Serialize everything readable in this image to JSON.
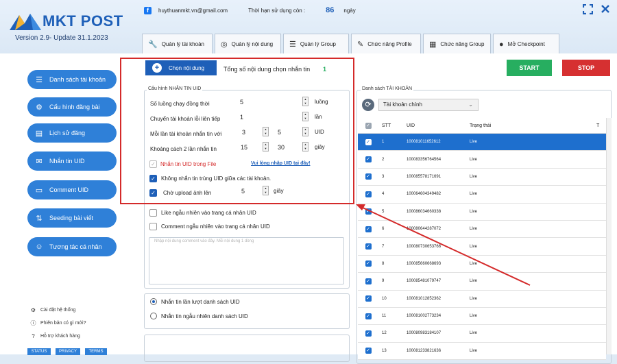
{
  "app": {
    "title": "MKT POST",
    "version": "Version 2.9- Update 31.1.2023",
    "email": "huythuanmkt.vn@gmail.com",
    "days_label": "Thời hạn sử dụng còn :",
    "days_value": "86",
    "days_unit": "ngày"
  },
  "tabs": [
    {
      "label": "Quản lý tài khoản",
      "icon": "wrench-icon"
    },
    {
      "label": "Quản lý nội dung",
      "icon": "content-icon"
    },
    {
      "label": "Quản lý Group",
      "icon": "list-icon"
    },
    {
      "label": "Chức năng Profile",
      "icon": "pencil-icon"
    },
    {
      "label": "Chức năng Group",
      "icon": "calendar-icon"
    },
    {
      "label": "Mở Checkpoint",
      "icon": "user-icon"
    }
  ],
  "sidebar": {
    "items": [
      {
        "label": "Danh sách tài khoản",
        "icon": "list-icon"
      },
      {
        "label": "Cấu hình đăng bài",
        "icon": "gears-icon"
      },
      {
        "label": "Lịch sử đăng",
        "icon": "history-icon"
      },
      {
        "label": "Nhắn tin UID",
        "icon": "message-icon"
      },
      {
        "label": "Comment UID",
        "icon": "comment-icon"
      },
      {
        "label": "Seeding bài viết",
        "icon": "seeding-icon"
      },
      {
        "label": "Tương tác cá nhân",
        "icon": "person-icon"
      }
    ],
    "footer": [
      "Cài đặt hệ thống",
      "Phiên bản có gì mới?",
      "Hỗ trợ khách hàng"
    ],
    "badges": [
      "STATUS",
      "PRIVACY",
      "TERMS"
    ]
  },
  "content": {
    "choose_button": "Chọn nội dung",
    "total_label": "Tổng số nội dung chọn nhắn tin",
    "total_value": "1"
  },
  "config": {
    "legend": "Cấu hình NHẮN TIN UID",
    "threads_label": "Số luồng chạy đồng thời",
    "threads_value": "5",
    "threads_unit": "luồng",
    "switch_label": "Chuyển tài khoản lỗi liên tiếp",
    "switch_value": "1",
    "switch_unit": "lần",
    "per_account_label": "Mỗi lần tài khoản nhắn tin với",
    "per_account_min": "3",
    "per_account_max": "5",
    "per_account_unit": "UID",
    "gap_label": "Khoảng cách 2 lần nhắn tin",
    "gap_min": "15",
    "gap_max": "30",
    "gap_unit": "giây",
    "file_label": "Nhắn tin UID trong File",
    "file_link": "Vui lòng nhập  UID tại đây!",
    "no_dup_label": "Không nhắn tin trùng UID giữa các tài khoản.",
    "wait_label": "Chờ upload ảnh lên",
    "wait_value": "5",
    "wait_unit": "giây",
    "like_label": "Like ngẫu nhiên vào trang cá nhân UID",
    "comment_label": "Comment ngẫu nhiên vào trang cá nhân UID",
    "comment_placeholder": "Nhập nội dung comment vào đây. Mỗi nội dung 1 dòng",
    "radio_seq": "Nhắn tin lần lượt danh sách UID",
    "radio_rand": "Nhắn tin ngẫu nhiên danh sách UID"
  },
  "actions": {
    "start": "START",
    "stop": "STOP"
  },
  "accounts": {
    "legend": "Danh sách TÀI KHOẢN",
    "dropdown": "Tài khoản chính",
    "columns": [
      "STT",
      "UID",
      "Trạng thái",
      "T"
    ],
    "rows": [
      {
        "stt": "1",
        "uid": "100081011652612",
        "status": "Live"
      },
      {
        "stt": "2",
        "uid": "100083356764564",
        "status": "Live"
      },
      {
        "stt": "3",
        "uid": "100085578171691",
        "status": "Live"
      },
      {
        "stt": "4",
        "uid": "100064604349482",
        "status": "Live"
      },
      {
        "stt": "5",
        "uid": "100086034660338",
        "status": "Live"
      },
      {
        "stt": "6",
        "uid": "100080644287072",
        "status": "Live"
      },
      {
        "stt": "7",
        "uid": "100080730653766",
        "status": "Live"
      },
      {
        "stt": "8",
        "uid": "100085660668693",
        "status": "Live"
      },
      {
        "stt": "9",
        "uid": "100085481079747",
        "status": "Live"
      },
      {
        "stt": "10",
        "uid": "100081012852362",
        "status": "Live"
      },
      {
        "stt": "11",
        "uid": "100081002773234",
        "status": "Live"
      },
      {
        "stt": "12",
        "uid": "100080983184107",
        "status": "Live"
      },
      {
        "stt": "13",
        "uid": "100081233821636",
        "status": "Live"
      }
    ]
  }
}
